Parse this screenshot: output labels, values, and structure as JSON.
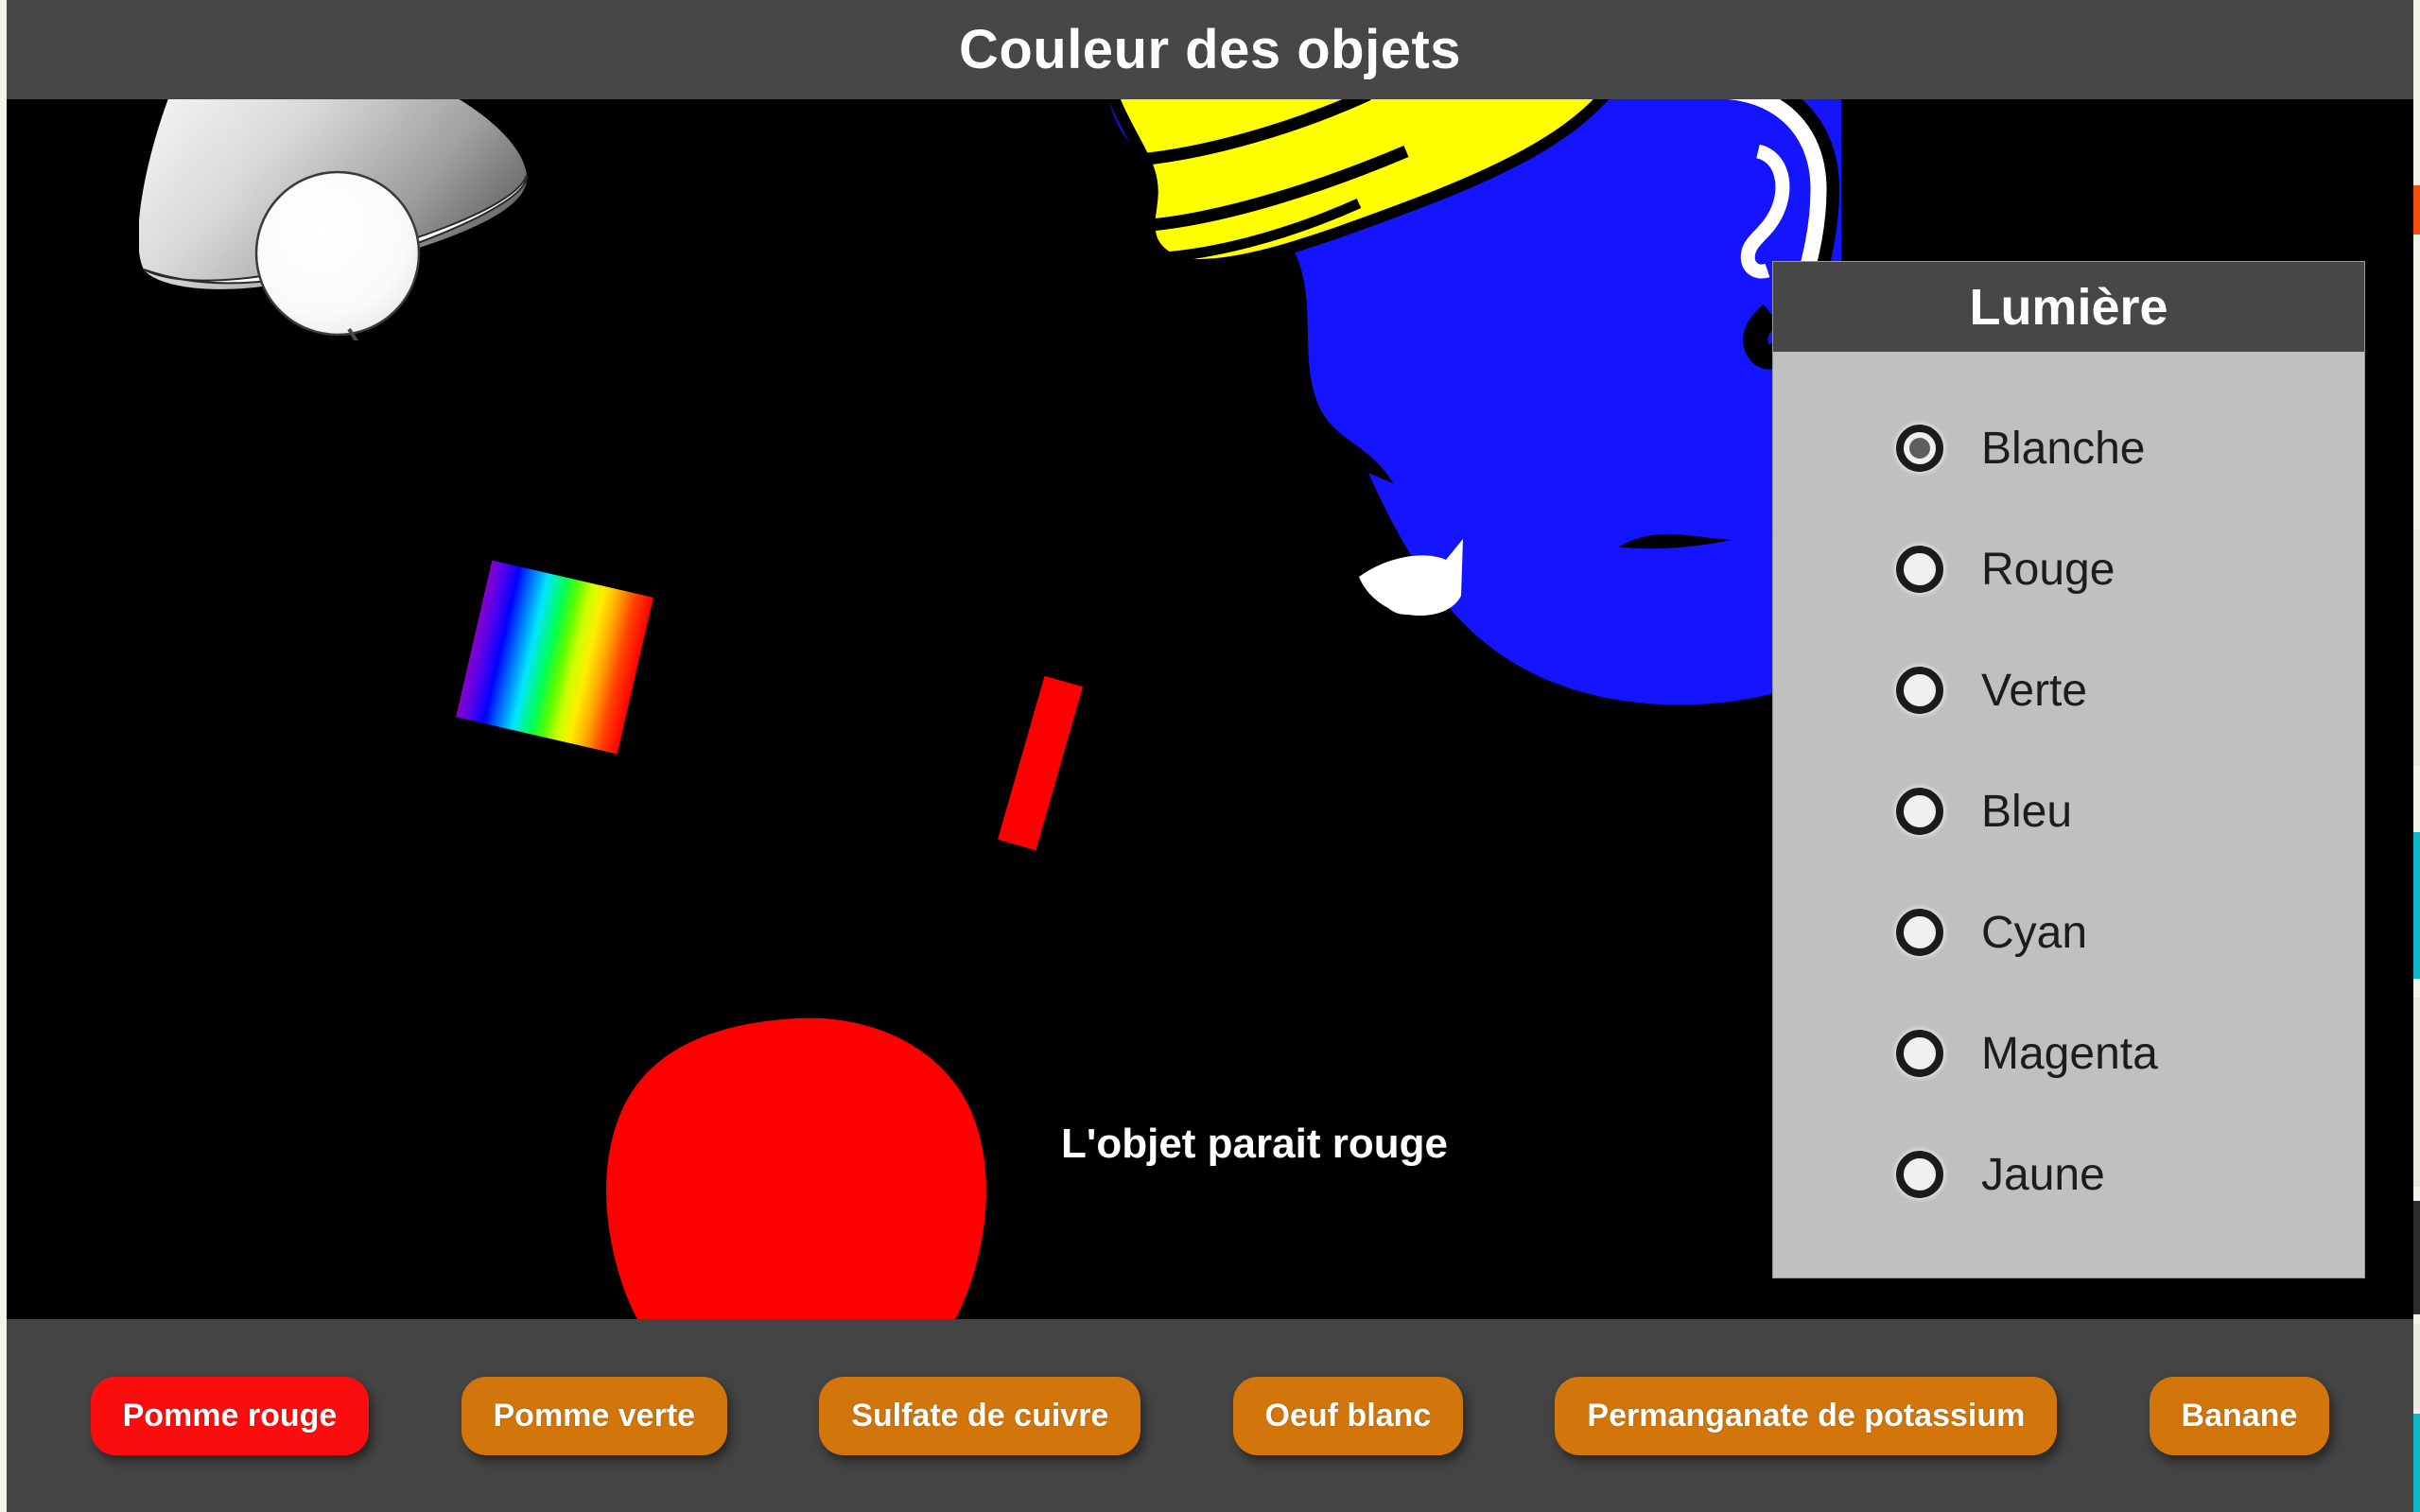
{
  "header": {
    "title": "Couleur des objets"
  },
  "stage": {
    "background_color": "#000000",
    "result_text": "L'objet parait rouge",
    "lamp": {
      "name": "lamp",
      "color": "#ffffff"
    },
    "incident_beam": {
      "name": "spectrum-beam",
      "description": "rainbow spectrum beam from lamp to object",
      "colors": [
        "#8800cc",
        "#0000ff",
        "#00e5ff",
        "#00ff55",
        "#ffee00",
        "#ffaa00",
        "#ff0000"
      ]
    },
    "reflected_beam": {
      "name": "reflected-beam",
      "description": "red beam from object to observer",
      "color": "#ff0000"
    },
    "observer": {
      "name": "observer-head",
      "skin_color": "#1414ff",
      "hair_color": "#ffff00",
      "outline_color": "#000000"
    },
    "object": {
      "name": "red-apple",
      "color": "#ff0000"
    }
  },
  "light_panel": {
    "title": "Lumière",
    "header_color": "#474747",
    "body_color": "#c0c0c0",
    "selected": "Blanche",
    "options": [
      {
        "label": "Blanche",
        "selected": true
      },
      {
        "label": "Rouge",
        "selected": false
      },
      {
        "label": "Verte",
        "selected": false
      },
      {
        "label": "Bleu",
        "selected": false
      },
      {
        "label": "Cyan",
        "selected": false
      },
      {
        "label": "Magenta",
        "selected": false
      },
      {
        "label": "Jaune",
        "selected": false
      }
    ]
  },
  "footer": {
    "background_color": "#444444",
    "active_color": "#fc0d0d",
    "inactive_color": "#d2760c",
    "buttons": [
      {
        "label": "Pomme rouge",
        "active": true
      },
      {
        "label": "Pomme verte",
        "active": false
      },
      {
        "label": "Sulfate de cuivre",
        "active": false
      },
      {
        "label": "Oeuf blanc",
        "active": false
      },
      {
        "label": "Permanganate de potassium",
        "active": false
      },
      {
        "label": "Banane",
        "active": false
      }
    ]
  }
}
